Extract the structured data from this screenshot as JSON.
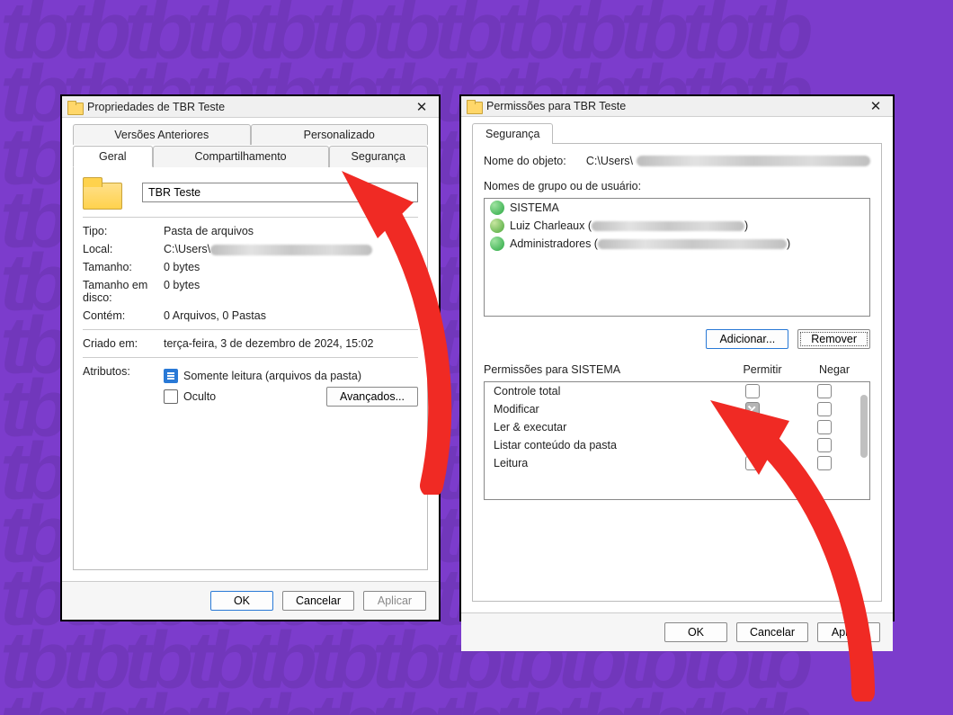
{
  "bg_pattern": "tbtbtbtbtbtbtbtbtbtbtbtbtb\ntbtbtbtbtbtbtbtbtbtbtbtbtb\ntbtbtbtbtbtbtbtbtbtbtbtbtb\ntbtbtbtbtbtbtbtbtbtbtbtbtb\ntbtbtbtbtbtbtbtbtbtbtbtbtb\ntbtbtbtbtbtbtbtbtbtbtbtbtb\ntbtbtbtbtbtbtbtbtbtbtbtbtb\ntbtbtbtbtbtbtbtbtbtbtbtbtb\ntbtbtbtbtbtbtbtbtbtbtbtbtb\ntbtbtbtbtbtbtbtbtbtbtbtbtb\ntbtbtbtbtbtbtbtbtbtbtbtbtb\ntbtbtbtbtbtbtbtbtbtbtbtbtb",
  "dialog1": {
    "title": "Propriedades de TBR Teste",
    "tabs_top": {
      "versoes": "Versões Anteriores",
      "personalizado": "Personalizado"
    },
    "tabs_bottom": {
      "geral": "Geral",
      "compart": "Compartilhamento",
      "seguranca": "Segurança"
    },
    "name_value": "TBR Teste",
    "fields": {
      "tipo_label": "Tipo:",
      "local_label": "Local:",
      "tamanho_label": "Tamanho:",
      "tamanho_disco_label": "Tamanho em disco:",
      "contem_label": "Contém:",
      "criado_label": "Criado em:",
      "atributos_label": "Atributos:",
      "tipo_value": "Pasta de arquivos",
      "local_prefix": "C:\\Users\\",
      "tamanho_value": "0 bytes",
      "tamanho_disco_value": "0 bytes",
      "contem_value": "0 Arquivos, 0 Pastas",
      "criado_value": "terça-feira, 3 de dezembro de 2024, 15:02",
      "attr_ro": "Somente leitura (arquivos da pasta)",
      "attr_hidden": "Oculto"
    },
    "btn_avancados": "Avançados...",
    "btn_ok": "OK",
    "btn_cancel": "Cancelar",
    "btn_apply": "Aplicar"
  },
  "dialog2": {
    "title": "Permissões para TBR Teste",
    "tab": "Segurança",
    "object_label": "Nome do objeto:",
    "object_prefix": "C:\\Users\\",
    "groups_label": "Nomes de grupo ou de usuário:",
    "groups": {
      "g1": "SISTEMA",
      "g2_prefix": "Luiz Charleaux (",
      "g2_suffix": ")",
      "g3_prefix": "Administradores (",
      "g3_suffix": ")"
    },
    "btn_add": "Adicionar...",
    "btn_remove": "Remover",
    "perm_title": "Permissões para SISTEMA",
    "col_allow": "Permitir",
    "col_deny": "Negar",
    "perms": {
      "p1": "Controle total",
      "p2": "Modificar",
      "p3": "Ler & executar",
      "p4": "Listar conteúdo da pasta",
      "p5": "Leitura"
    },
    "btn_ok": "OK",
    "btn_cancel": "Cancelar",
    "btn_apply": "Aplicar"
  }
}
